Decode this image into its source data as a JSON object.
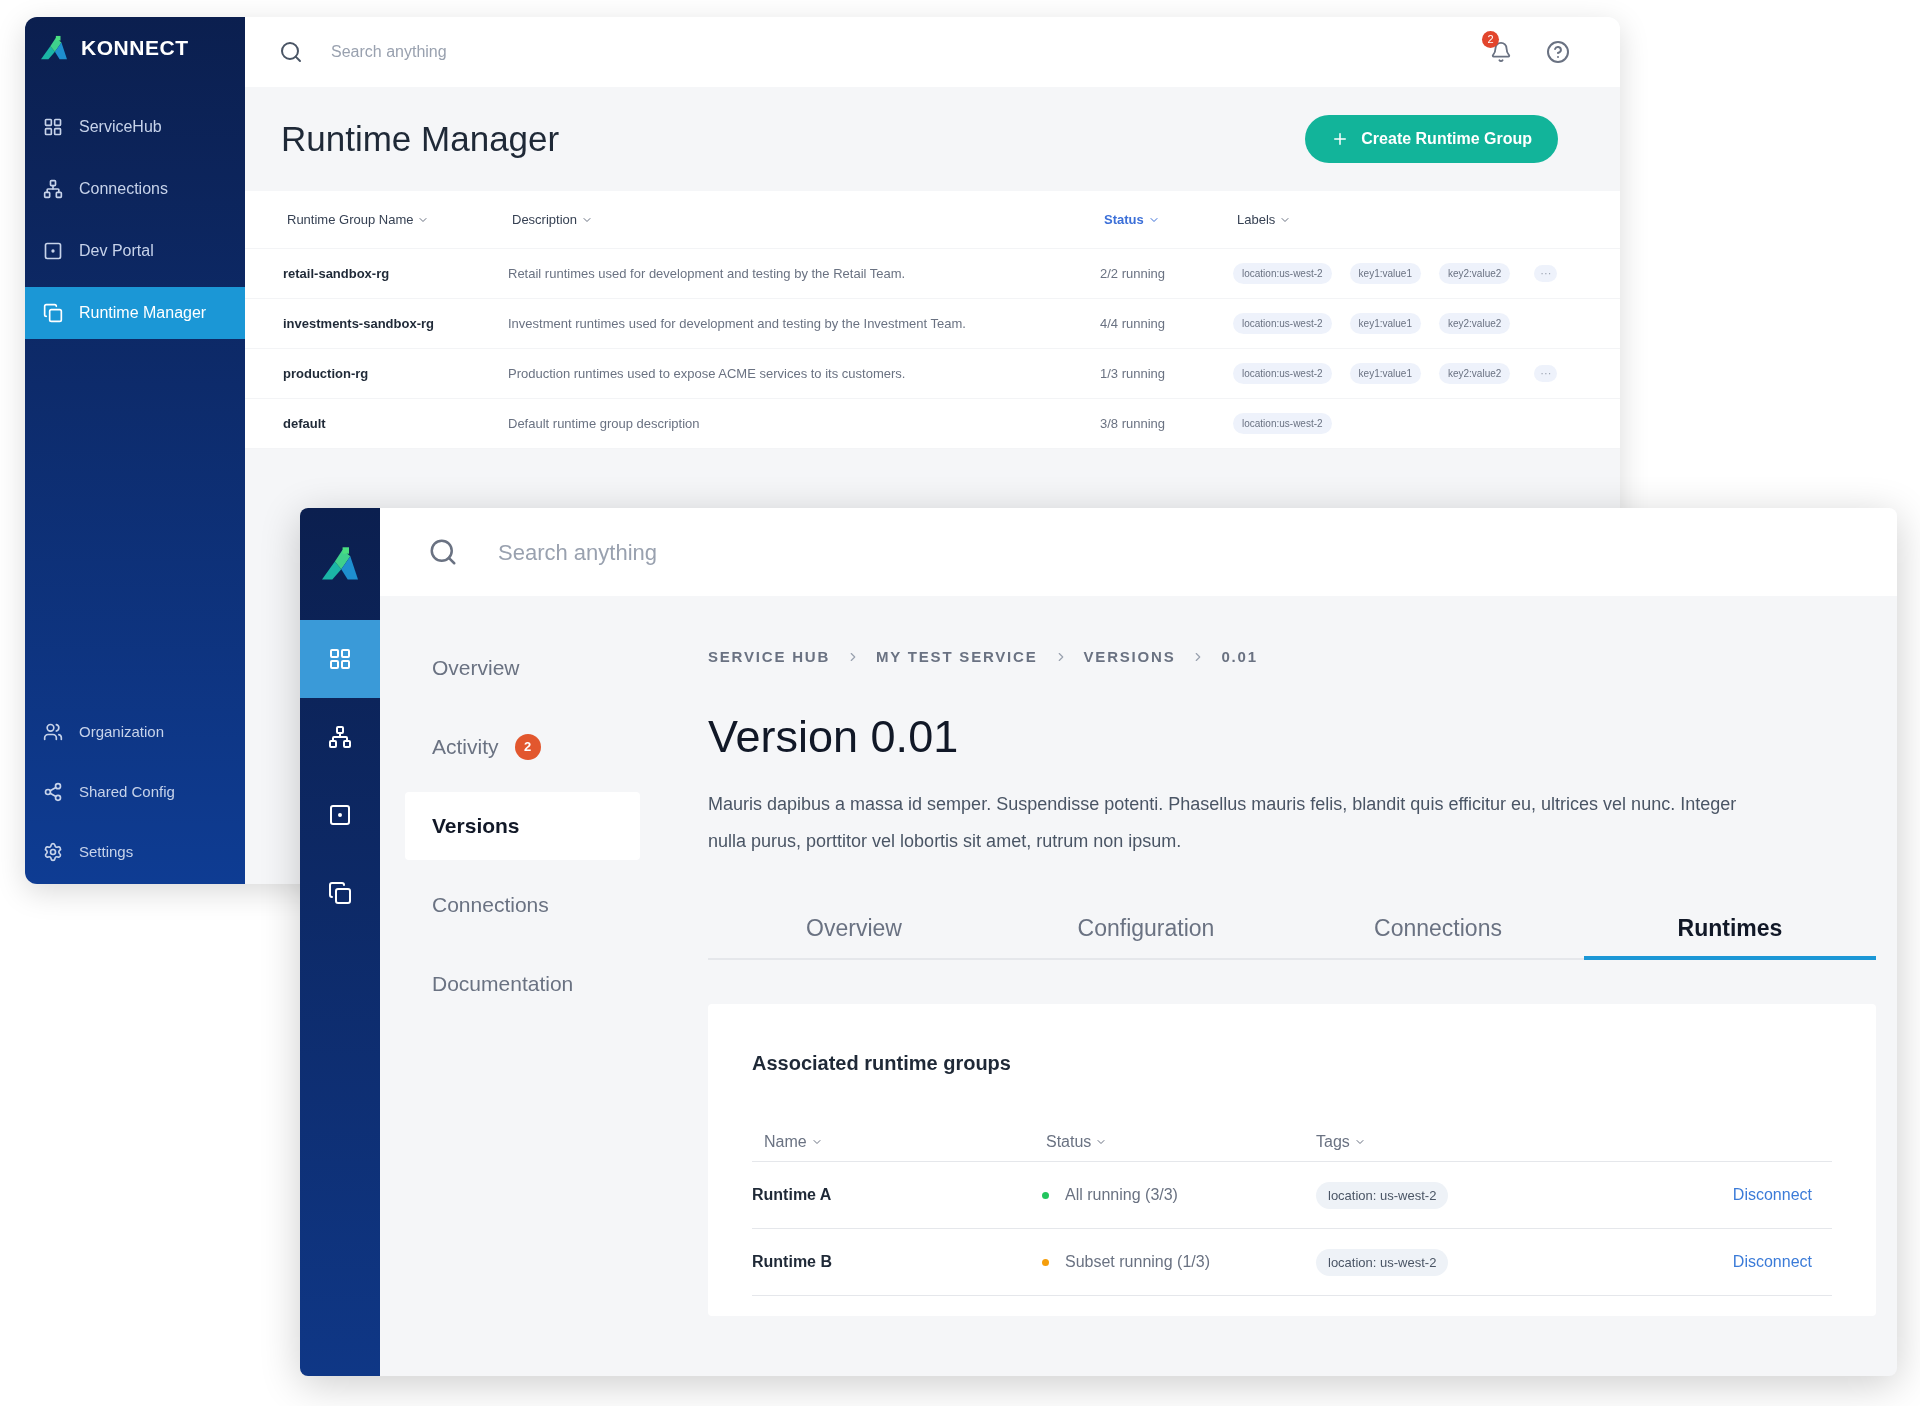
{
  "back_window": {
    "brand": "KONNECT",
    "nav_items": [
      {
        "label": "ServiceHub",
        "selected": false
      },
      {
        "label": "Connections",
        "selected": false
      },
      {
        "label": "Dev Portal",
        "selected": false
      },
      {
        "label": "Runtime Manager",
        "selected": true
      }
    ],
    "bottom_nav_items": [
      {
        "label": "Organization",
        "selected": false
      },
      {
        "label": "Shared Config",
        "selected": false
      },
      {
        "label": "Settings",
        "selected": false
      }
    ],
    "search": {
      "placeholder": "Search anything"
    },
    "notifications_badge": "2",
    "title": "Runtime Manager",
    "create_button": "Create Runtime Group",
    "table": {
      "columns": [
        {
          "label": "Runtime Group Name",
          "sorted": false
        },
        {
          "label": "Description",
          "sorted": false
        },
        {
          "label": "Status",
          "sorted": true
        },
        {
          "label": "Labels",
          "sorted": false
        }
      ],
      "rows": [
        {
          "name": "retail-sandbox-rg",
          "description": "Retail runtimes used for development and testing by the Retail Team.",
          "status": "2/2 running",
          "labels": [
            "location:us-west-2",
            "key1:value1",
            "key2:value2"
          ],
          "more": "···"
        },
        {
          "name": "investments-sandbox-rg",
          "description": "Investment runtimes used for development and testing by the Investment Team.",
          "status": "4/4 running",
          "labels": [
            "location:us-west-2",
            "key1:value1",
            "key2:value2"
          ]
        },
        {
          "name": "production-rg",
          "description": "Production runtimes used to expose ACME services to its customers.",
          "status": "1/3 running",
          "labels": [
            "location:us-west-2",
            "key1:value1",
            "key2:value2"
          ],
          "more": "···"
        },
        {
          "name": "default",
          "description": "Default runtime group description",
          "status": "3/8 running",
          "labels": [
            "location:us-west-2"
          ]
        }
      ]
    }
  },
  "front_window": {
    "rail_items": [
      {
        "selected": true
      },
      {
        "selected": false
      },
      {
        "selected": false
      },
      {
        "selected": false
      }
    ],
    "search": {
      "placeholder": "Search anything"
    },
    "side_nav": [
      {
        "label": "Overview",
        "selected": false
      },
      {
        "label": "Activity",
        "selected": false,
        "badge": "2"
      },
      {
        "label": "Versions",
        "selected": true
      },
      {
        "label": "Connections",
        "selected": false
      },
      {
        "label": "Documentation",
        "selected": false
      }
    ],
    "breadcrumb": [
      "SERVICE HUB",
      "MY TEST SERVICE",
      "VERSIONS",
      "0.01"
    ],
    "title": "Version 0.01",
    "description": "Mauris dapibus a massa id semper. Suspendisse potenti. Phasellus mauris felis, blandit quis efficitur eu, ultrices vel nunc. Integer nulla purus, porttitor vel lobortis sit amet, rutrum non ipsum.",
    "tabs": [
      {
        "label": "Overview",
        "selected": false
      },
      {
        "label": "Configuration",
        "selected": false
      },
      {
        "label": "Connections",
        "selected": false
      },
      {
        "label": "Runtimes",
        "selected": true
      }
    ],
    "card": {
      "title": "Associated runtime groups",
      "columns": [
        "Name",
        "Status",
        "Tags"
      ],
      "rows": [
        {
          "name": "Runtime A",
          "status": "All running (3/3)",
          "color": "#22c55e",
          "tag": "location: us-west-2",
          "action": "Disconnect"
        },
        {
          "name": "Runtime B",
          "status": "Subset running (1/3)",
          "color": "#f59e0b",
          "tag": "location: us-west-2",
          "action": "Disconnect"
        }
      ]
    }
  }
}
